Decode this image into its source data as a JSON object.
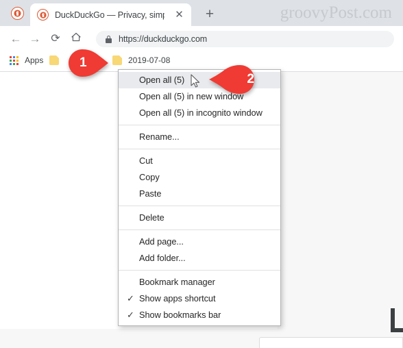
{
  "browser": {
    "tab": {
      "title": "DuckDuckGo — Privacy, simplifie",
      "favicon": "duckduckgo-icon",
      "close_label": "✕"
    },
    "new_tab_label": "+",
    "watermark": "groovyPost.com",
    "toolbar": {
      "back_label": "←",
      "forward_label": "→",
      "reload_label": "⟳",
      "home_label": "⌂",
      "url": "https://duckduckgo.com",
      "security_icon": "lock-icon"
    },
    "bookmarks_bar": {
      "apps_label": "Apps",
      "items": [
        {
          "label": "",
          "icon": "folder-icon"
        },
        {
          "label": "2019-07-08",
          "icon": "folder-icon"
        }
      ]
    }
  },
  "context_menu": {
    "groups": [
      {
        "items": [
          {
            "label": "Open all (5)",
            "highlighted": true,
            "checked": false
          },
          {
            "label": "Open all (5) in new window",
            "highlighted": false,
            "checked": false
          },
          {
            "label": "Open all (5) in incognito window",
            "highlighted": false,
            "checked": false
          }
        ]
      },
      {
        "items": [
          {
            "label": "Rename...",
            "highlighted": false,
            "checked": false
          }
        ]
      },
      {
        "items": [
          {
            "label": "Cut",
            "highlighted": false,
            "checked": false
          },
          {
            "label": "Copy",
            "highlighted": false,
            "checked": false
          },
          {
            "label": "Paste",
            "highlighted": false,
            "checked": false
          }
        ]
      },
      {
        "items": [
          {
            "label": "Delete",
            "highlighted": false,
            "checked": false
          }
        ]
      },
      {
        "items": [
          {
            "label": "Add page...",
            "highlighted": false,
            "checked": false
          },
          {
            "label": "Add folder...",
            "highlighted": false,
            "checked": false
          }
        ]
      },
      {
        "items": [
          {
            "label": "Bookmark manager",
            "highlighted": false,
            "checked": false
          },
          {
            "label": "Show apps shortcut",
            "highlighted": false,
            "checked": true
          },
          {
            "label": "Show bookmarks bar",
            "highlighted": false,
            "checked": true
          }
        ]
      }
    ],
    "check_glyph": "✓"
  },
  "annotations": [
    {
      "number": "1",
      "direction": "right"
    },
    {
      "number": "2",
      "direction": "left"
    }
  ],
  "colors": {
    "marker_red": "#ef3b33",
    "tabstrip_bg": "#dee1e6",
    "omnibox_bg": "#f1f3f4",
    "folder_yellow": "#f8d775",
    "brand_orange": "#de5833",
    "menu_highlight": "#e8eaed",
    "watermark_gray": "#c6c9ce"
  }
}
